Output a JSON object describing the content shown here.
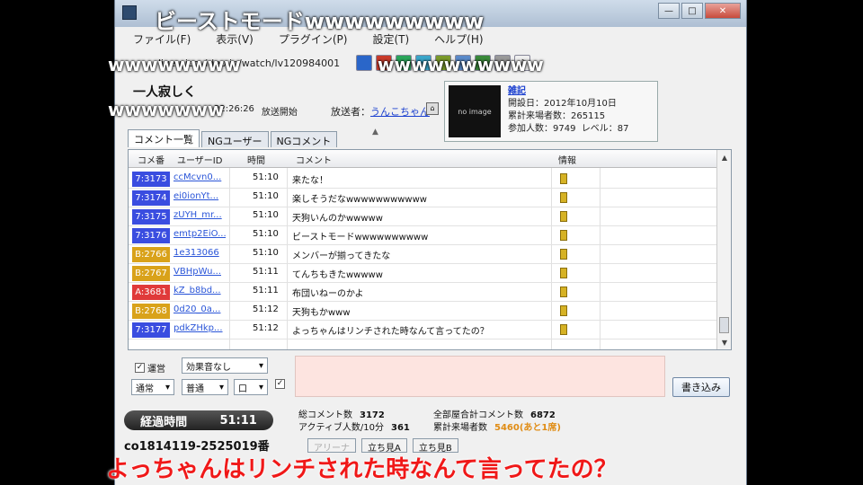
{
  "window": {
    "minimize": "—",
    "maximize": "□",
    "close": "✕"
  },
  "menu": [
    "ファイル(F)",
    "表示(V)",
    "プラグイン(P)",
    "設定(T)",
    "ヘルプ(H)"
  ],
  "url": "live.nicovideo.jp/watch/lv120984001",
  "broadcast": {
    "title": "一人寂しく",
    "start_time": "22:26:26",
    "start_label": "放送開始",
    "broadcaster_label": "放送者：",
    "broadcaster_name": "うんこちゃん"
  },
  "community": {
    "thumb_text": "no image",
    "name": "雑記",
    "opened": "開設日：2012年10月10日",
    "visitors": "累計来場者数：265115",
    "members": "参加人数：9749",
    "level": "レベル：87"
  },
  "tabs": [
    "コメント一覧",
    "NGユーザー",
    "NGコメント"
  ],
  "grid_headers": {
    "no": "コメ番",
    "uid": "ユーザーID",
    "time": "時間",
    "comment": "コメント",
    "info": "情報"
  },
  "colors": {
    "blue": "#3a4de0",
    "yellow": "#d9a21a",
    "red": "#e03a3a"
  },
  "rows": [
    {
      "no": "7:3173",
      "uid": "ccMcvn0...",
      "time": "51:10",
      "comment": "来たな！",
      "color": "#3a4de0"
    },
    {
      "no": "7:3174",
      "uid": "ei0ionYt...",
      "time": "51:10",
      "comment": "楽しそうだなwwwwwwwwwww",
      "color": "#3a4de0"
    },
    {
      "no": "7:3175",
      "uid": "zUYH_mr...",
      "time": "51:10",
      "comment": "天狗いんのかwwwww",
      "color": "#3a4de0"
    },
    {
      "no": "7:3176",
      "uid": "emtp2EiO...",
      "time": "51:10",
      "comment": "ビーストモードwwwwwwwwww",
      "color": "#3a4de0"
    },
    {
      "no": "B:2766",
      "uid": "1e313066",
      "time": "51:10",
      "comment": "メンバーが揃ってきたな",
      "color": "#d9a21a"
    },
    {
      "no": "B:2767",
      "uid": "VBHpWu...",
      "time": "51:11",
      "comment": "てんちもきたwwwww",
      "color": "#d9a21a"
    },
    {
      "no": "A:3681",
      "uid": "kZ_b8bd...",
      "time": "51:11",
      "comment": "布団いねーのかよ",
      "color": "#e03a3a"
    },
    {
      "no": "B:2768",
      "uid": "0d20_0a...",
      "time": "51:12",
      "comment": "天狗もかwww",
      "color": "#d9a21a"
    },
    {
      "no": "7:3177",
      "uid": "pdkZHkp...",
      "time": "51:12",
      "comment": "よっちゃんはリンチされた時なんて言ってたの？",
      "color": "#3a4de0"
    }
  ],
  "composer": {
    "operator_label": "運営",
    "effect": "効果音なし",
    "mode": "通常",
    "size": "普通",
    "color_sel": "口",
    "submit": "書き込み"
  },
  "status": {
    "elapsed_label": "経過時間",
    "elapsed_value": "51:11",
    "total_comments_label": "総コメント数",
    "total_comments": "3172",
    "active_label": "アクティブ人数/10分",
    "active": "361",
    "all_rooms_label": "全部屋合計コメント数",
    "all_rooms": "6872",
    "visitors_label": "累計来場者数",
    "visitors": "5460(あと1席)",
    "community_id": "co1814119-2525019番",
    "buttons": [
      "アリーナ",
      "立ち見A",
      "立ち見B"
    ]
  },
  "overlays": {
    "title": "ビーストモードwwwwwwwww",
    "w1": "wwwwwwww",
    "w2": "wwwwwwwwww",
    "w3": "wwwwwww",
    "bottom": "よっちゃんはリンチされた時なんて言ってたの？"
  }
}
